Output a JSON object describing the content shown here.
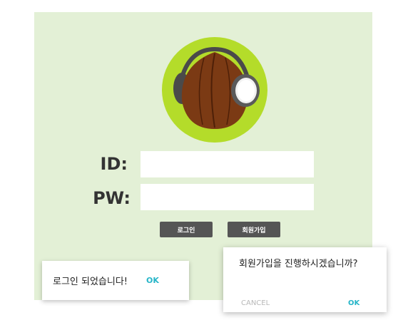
{
  "form": {
    "id_label": "ID:",
    "pw_label": "PW:",
    "id_value": "",
    "pw_value": ""
  },
  "buttons": {
    "login": "로그인",
    "signup": "회원가입"
  },
  "toast": {
    "message": "로그인 되었습니다!",
    "ok": "OK"
  },
  "dialog": {
    "message": "회원가입을 진행하시겠습니까?",
    "cancel": "CANCEL",
    "ok": "OK"
  },
  "colors": {
    "panel": "#e3f0d6",
    "logo_circle": "#b4dc2a",
    "chestnut": "#7b3a14",
    "headphone": "#4a4a4a",
    "accent": "#26b5c8",
    "button": "#555555"
  },
  "icons": {
    "logo": "chestnut-headphones-logo"
  }
}
